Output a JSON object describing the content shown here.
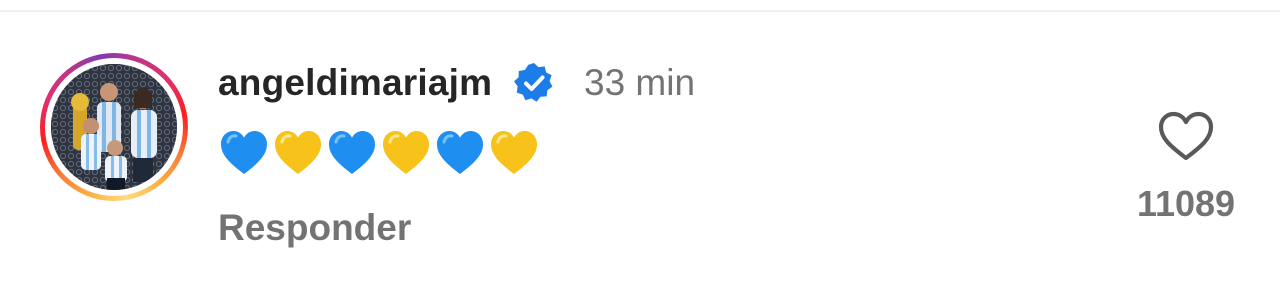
{
  "comment": {
    "username": "angeldimariajm",
    "verified_icon": "verified-badge-icon",
    "timestamp": "33 min",
    "text_icons": [
      "blue-heart-icon",
      "yellow-heart-icon",
      "blue-heart-icon",
      "yellow-heart-icon",
      "blue-heart-icon",
      "yellow-heart-icon"
    ],
    "reply_label": "Responder",
    "like_icon": "heart-outline-icon",
    "like_count": "11089"
  },
  "colors": {
    "blue_heart": "#1e8ff0",
    "yellow_heart": "#f7c21a",
    "verified_blue": "#1d7de8",
    "secondary_text": "#737373",
    "primary_text": "#262626"
  }
}
